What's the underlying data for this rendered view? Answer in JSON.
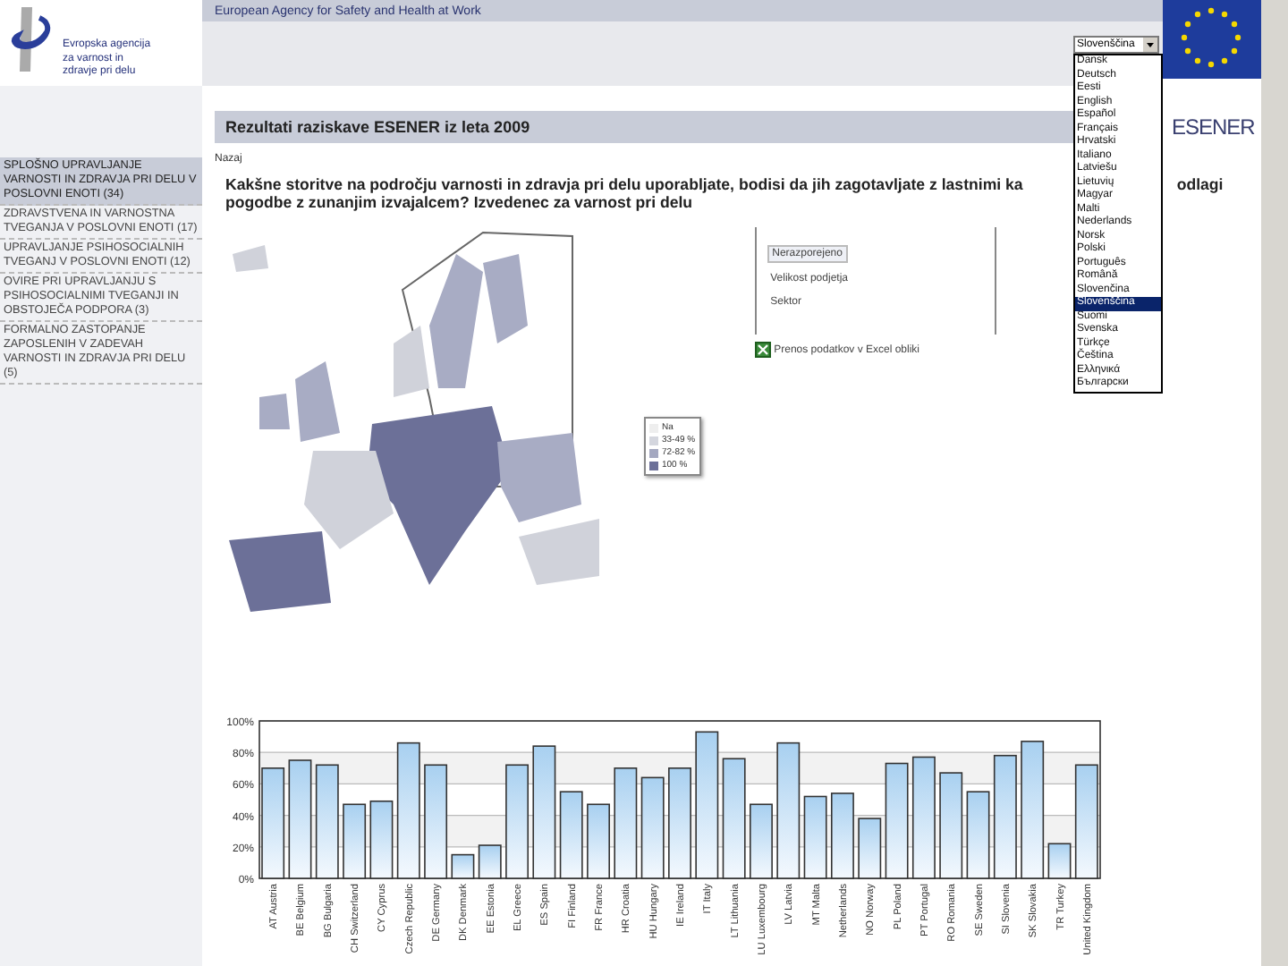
{
  "header": {
    "logo_text": "Evropska agencija za varnost in zdravje pri delu",
    "agency_title": "European Agency for Safety and Health at Work",
    "language_select": "Slovenščina"
  },
  "language_menu": [
    {
      "label": "Dansk",
      "selected": false
    },
    {
      "label": "Deutsch",
      "selected": false
    },
    {
      "label": "Eesti",
      "selected": false
    },
    {
      "label": "English",
      "selected": false
    },
    {
      "label": "Español",
      "selected": false
    },
    {
      "label": "Français",
      "selected": false
    },
    {
      "label": "Hrvatski",
      "selected": false
    },
    {
      "label": "Italiano",
      "selected": false
    },
    {
      "label": "Latviešu",
      "selected": false
    },
    {
      "label": "Lietuvių",
      "selected": false
    },
    {
      "label": "Magyar",
      "selected": false
    },
    {
      "label": "Malti",
      "selected": false
    },
    {
      "label": "Nederlands",
      "selected": false
    },
    {
      "label": "Norsk",
      "selected": false
    },
    {
      "label": "Polski",
      "selected": false
    },
    {
      "label": "Português",
      "selected": false
    },
    {
      "label": "Română",
      "selected": false
    },
    {
      "label": "Slovenčina",
      "selected": false
    },
    {
      "label": "Slovenščina",
      "selected": true
    },
    {
      "label": "Suomi",
      "selected": false
    },
    {
      "label": "Svenska",
      "selected": false
    },
    {
      "label": "Türkçe",
      "selected": false
    },
    {
      "label": "Čeština",
      "selected": false
    },
    {
      "label": "Ελληνικά",
      "selected": false
    },
    {
      "label": "Български",
      "selected": false
    }
  ],
  "sidebar": {
    "items": [
      {
        "label": "SPLOŠNO UPRAVLJANJE VARNOSTI IN ZDRAVJA PRI DELU V POSLOVNI ENOTI (34)",
        "selected": true
      },
      {
        "label": "ZDRAVSTVENA IN VARNOSTNA TVEGANJA V POSLOVNI ENOTI (17)",
        "selected": false
      },
      {
        "label": "UPRAVLJANJE PSIHOSOCIALNIH TVEGANJ V POSLOVNI ENOTI (12)",
        "selected": false
      },
      {
        "label": "OVIRE PRI UPRAVLJANJU S PSIHOSOCIALNIMI TVEGANJI IN OBSTOJEČA PODPORA (3)",
        "selected": false
      },
      {
        "label": "FORMALNO ZASTOPANJE ZAPOSLENIH V ZADEVAH VARNOSTI IN ZDRAVJA PRI DELU (5)",
        "selected": false
      }
    ]
  },
  "main": {
    "title": "Rezultati raziskave ESENER iz leta 2009",
    "logo": "ESENER",
    "back_link": "Nazaj",
    "question_line_1": "Kakšne storitve na področju varnosti in zdravja pri delu uporabljate, bodisi da jih zagotavljate z lastnimi ka",
    "question_line_1_end": "odlagi",
    "question_line_2": "pogodbe z zunanjim izvajalcem? Izvedenec za varnost pri delu",
    "legend": [
      {
        "label": "Na",
        "color": "#eeeeee"
      },
      {
        "label": "33-49 %",
        "color": "#d4d6de"
      },
      {
        "label": "72-82 %",
        "color": "#a4a8c0"
      },
      {
        "label": "100 %",
        "color": "#6c7098"
      }
    ],
    "breakdowns": [
      {
        "label": "Nerazporejeno",
        "selected": true
      },
      {
        "label": "Velikost podjetja",
        "selected": false
      },
      {
        "label": "Sektor",
        "selected": false
      }
    ],
    "export_link": "Prenos podatkov v Excel obliki",
    "chart_data": {
      "type": "bar",
      "categories": [
        "AT Austria",
        "BE Belgium",
        "BG Bulgaria",
        "CH Switzerland",
        "CY Cyprus",
        "Czech Republic",
        "DE Germany",
        "DK Denmark",
        "EE Estonia",
        "EL Greece",
        "ES Spain",
        "FI Finland",
        "FR France",
        "HR Croatia",
        "HU Hungary",
        "IE Ireland",
        "IT Italy",
        "LT Lithuania",
        "LU Luxembourg",
        "LV Latvia",
        "MT Malta",
        "Netherlands",
        "NO Norway",
        "PL Poland",
        "PT Portugal",
        "RO Romania",
        "SE Sweden",
        "SI Slovenia",
        "SK Slovakia",
        "TR Turkey",
        "United Kingdom"
      ],
      "values": [
        70,
        75,
        72,
        47,
        49,
        86,
        72,
        15,
        21,
        72,
        84,
        55,
        47,
        70,
        64,
        70,
        93,
        76,
        47,
        86,
        52,
        54,
        38,
        73,
        77,
        67,
        55,
        78,
        87,
        22,
        72
      ],
      "ylim": [
        0,
        100
      ],
      "grid": true,
      "yticks": [
        {
          "value": 0,
          "label": "0%"
        },
        {
          "value": 20,
          "label": "20%"
        },
        {
          "value": 40,
          "label": "40%"
        },
        {
          "value": 60,
          "label": "60%"
        },
        {
          "value": 80,
          "label": "80%"
        },
        {
          "value": 100,
          "label": "100%"
        }
      ]
    }
  }
}
